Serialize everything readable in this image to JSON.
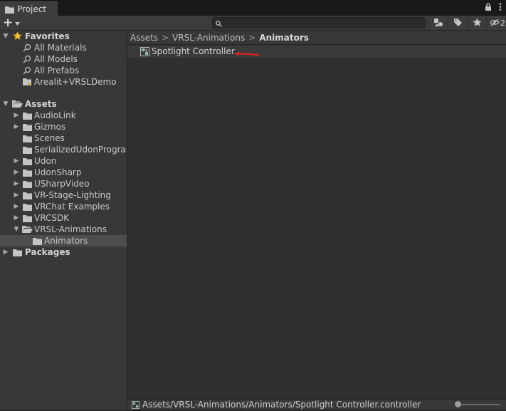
{
  "window": {
    "tab_title": "Project"
  },
  "toolbar": {
    "add_label": "+",
    "search_placeholder": "",
    "hidden_count": "2"
  },
  "tree": {
    "favorites": {
      "label": "Favorites",
      "items": [
        "All Materials",
        "All Models",
        "All Prefabs",
        "Arealit+VRSLDemo"
      ]
    },
    "assets": {
      "label": "Assets",
      "items": [
        "AudioLink",
        "Gizmos",
        "Scenes",
        "SerializedUdonProgran",
        "Udon",
        "UdonSharp",
        "USharpVideo",
        "VR-Stage-Lighting",
        "VRChat Examples",
        "VRCSDK",
        "VRSL-Animations"
      ],
      "child_of_vrsl": "Animators"
    },
    "packages": {
      "label": "Packages"
    }
  },
  "breadcrumb": [
    "Assets",
    "VRSL-Animations",
    "Animators"
  ],
  "asset_list": [
    {
      "name": "Spotlight Controller"
    }
  ],
  "status": {
    "path": "Assets/VRSL-Animations/Animators/Spotlight Controller.controller"
  },
  "colors": {
    "selection": "#4d4d4d",
    "annotation_arrow": "#e02020",
    "favorite_star": "#f0c030"
  }
}
